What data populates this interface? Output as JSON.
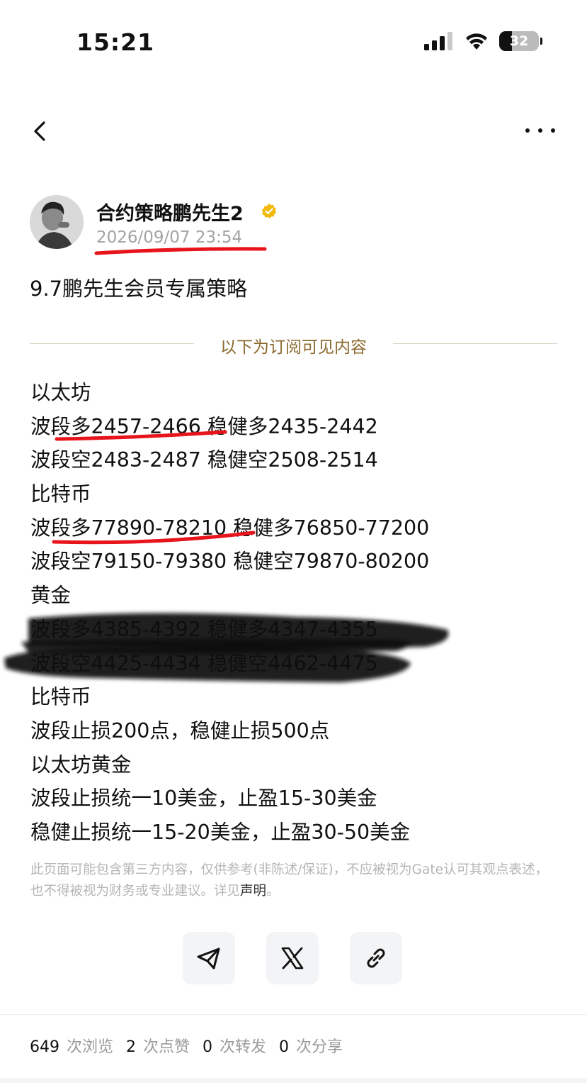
{
  "status_bar": {
    "time": "15:21",
    "battery": "32"
  },
  "author": {
    "name": "合约策略鹏先生2",
    "time": "2026/09/07 23:54"
  },
  "post": {
    "title": "9.7鹏先生会员专属策略",
    "divider_label": "以下为订阅可见内容",
    "lines": [
      "以太坊",
      "波段多2457-2466 稳健多2435-2442",
      "波段空2483-2487 稳健空2508-2514",
      "比特币",
      "波段多77890-78210 稳健多76850-77200",
      "波段空79150-79380 稳健空79870-80200",
      "黄金",
      "波段多4385-4392 稳健多4347-4355",
      "波段空4425-4434 稳健空4462-4475",
      "比特币",
      "波段止损200点，稳健止损500点",
      "以太坊黄金",
      "波段止损统一10美金，止盈15-30美金",
      "稳健止损统一15-20美金，止盈30-50美金"
    ],
    "disclaimer_text": "此页面可能包含第三方内容，仅供参考(非陈述/保证)，不应被视为Gate认可其观点表述，也不得被视为财务或专业建议。详见",
    "disclaimer_link": "声明",
    "disclaimer_end": "。"
  },
  "stats": {
    "views": "649",
    "views_label": "次浏览",
    "likes": "2",
    "likes_label": "次点赞",
    "reposts": "0",
    "reposts_label": "次转发",
    "shares": "0",
    "shares_label": "次分享"
  },
  "colors": {
    "accent_gold": "#8b6a2e",
    "verified": "#f0b90b",
    "annotation_red": "#e8141b"
  },
  "icons": {
    "back": "chevron-left-icon",
    "more": "more-dots-icon",
    "verified": "verified-badge-icon",
    "share_telegram": "telegram-icon",
    "share_x": "x-logo-icon",
    "share_link": "link-icon"
  }
}
